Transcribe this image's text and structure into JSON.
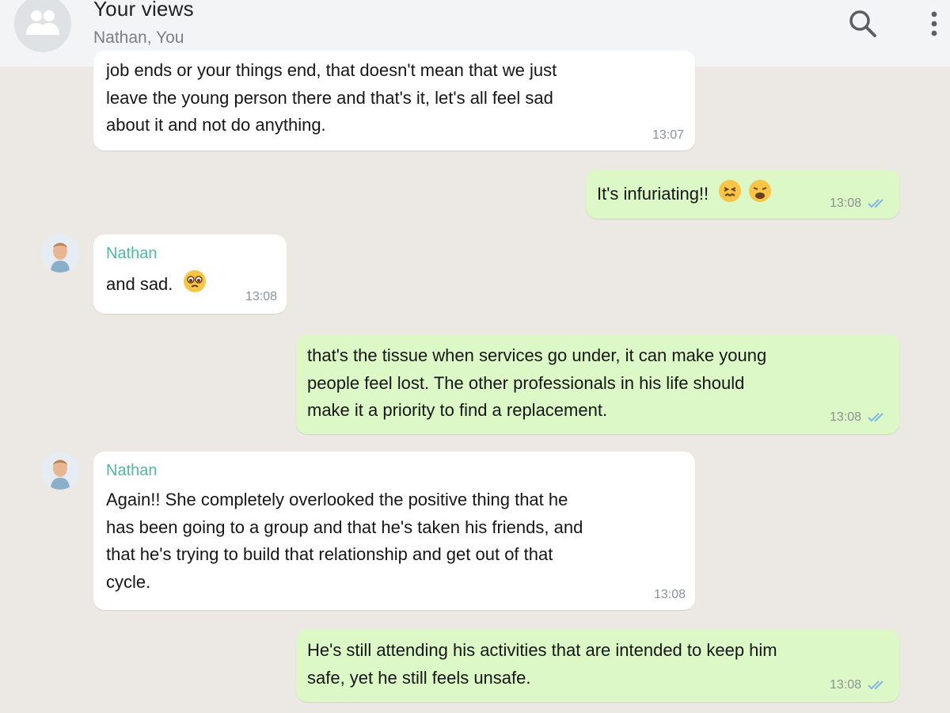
{
  "header": {
    "title": "Your views",
    "subtitle": "Nathan, You",
    "avatar_icon": "group-icon",
    "search_icon": "search-icon",
    "menu_icon": "more-vertical-icon"
  },
  "colors": {
    "incoming_bubble": "#ffffff",
    "outgoing_bubble": "#dcf8c6",
    "sender_name": "#4fb8a5",
    "read_ticks": "#7eb6e6",
    "chat_background": "#ece8e3"
  },
  "messages": [
    {
      "direction": "in",
      "sender": "",
      "lines": [
        "job ends or your things end, that doesn't mean that we just",
        "leave the young person there and that's it, let's all feel sad",
        "about it and not do anything."
      ],
      "time": "13:07"
    },
    {
      "direction": "out",
      "text": "It's infuriating!!",
      "emojis": [
        "confounded-face-emoji",
        "weary-face-emoji"
      ],
      "time": "13:08",
      "status": "read"
    },
    {
      "direction": "in",
      "sender": "Nathan",
      "text": "and sad.",
      "emojis": [
        "pleading-face-emoji"
      ],
      "time": "13:08"
    },
    {
      "direction": "out",
      "lines": [
        "that's the tissue when services go under, it can make young",
        "people feel lost. The other professionals in his life should",
        "make it a priority to find a replacement."
      ],
      "time": "13:08",
      "status": "read"
    },
    {
      "direction": "in",
      "sender": "Nathan",
      "lines": [
        "Again!! She completely overlooked the positive thing that he",
        "has been going to a group and that he's taken his friends, and",
        "that he's trying to build that relationship and get out of that",
        "cycle."
      ],
      "time": "13:08"
    },
    {
      "direction": "out",
      "lines": [
        "He's still attending his activities that are intended to keep him",
        "safe, yet he still feels unsafe."
      ],
      "time": "13:08",
      "status": "read"
    }
  ]
}
